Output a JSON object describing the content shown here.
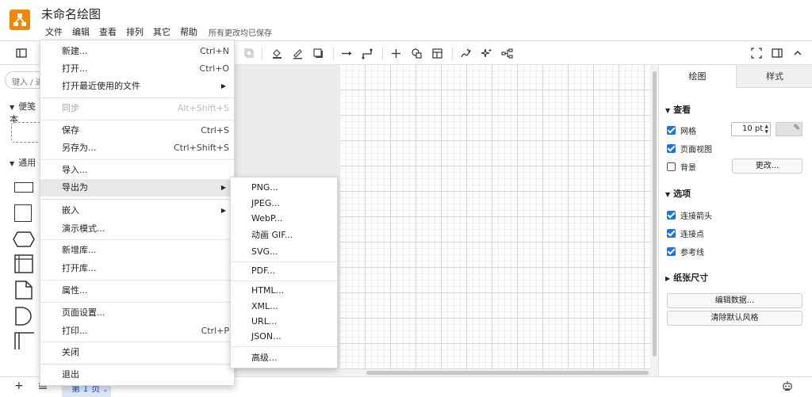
{
  "header": {
    "title": "未命名绘图",
    "menus": [
      "文件",
      "编辑",
      "查看",
      "排列",
      "其它",
      "帮助"
    ],
    "save_status": "所有更改均已保存"
  },
  "sidebar": {
    "search_placeholder": "键入 / 进",
    "sections": [
      {
        "label": "便笺本"
      },
      {
        "label": "通用"
      }
    ]
  },
  "file_menu": {
    "items": [
      {
        "label": "新建...",
        "shortcut": "Ctrl+N"
      },
      {
        "label": "打开...",
        "shortcut": "Ctrl+O"
      },
      {
        "label": "打开最近使用的文件",
        "submenu": true
      },
      {
        "label": "同步",
        "shortcut": "Alt+Shift+S",
        "disabled": true
      },
      {
        "label": "保存",
        "shortcut": "Ctrl+S"
      },
      {
        "label": "另存为...",
        "shortcut": "Ctrl+Shift+S"
      },
      {
        "label": "导入..."
      },
      {
        "label": "导出为",
        "submenu": true,
        "highlighted": true
      },
      {
        "label": "嵌入",
        "submenu": true
      },
      {
        "label": "演示模式..."
      },
      {
        "label": "新增库..."
      },
      {
        "label": "打开库..."
      },
      {
        "label": "属性..."
      },
      {
        "label": "页面设置..."
      },
      {
        "label": "打印...",
        "shortcut": "Ctrl+P"
      },
      {
        "label": "关闭"
      },
      {
        "label": "退出"
      }
    ]
  },
  "export_menu": {
    "items": [
      {
        "label": "PNG..."
      },
      {
        "label": "JPEG..."
      },
      {
        "label": "WebP..."
      },
      {
        "label": "动画 GIF..."
      },
      {
        "label": "SVG..."
      },
      {
        "label": "PDF..."
      },
      {
        "label": "HTML..."
      },
      {
        "label": "XML..."
      },
      {
        "label": "URL..."
      },
      {
        "label": "JSON..."
      },
      {
        "label": "高级..."
      }
    ]
  },
  "format_panel": {
    "tabs": [
      "绘图",
      "样式"
    ],
    "view_section": "查看",
    "grid_label": "网格",
    "grid_checked": true,
    "grid_size": "10 pt",
    "grid_color": "#e0e0e0",
    "page_view_label": "页面视图",
    "page_view_checked": true,
    "background_label": "背景",
    "background_checked": false,
    "change_button": "更改...",
    "options_section": "选项",
    "connection_arrows_label": "连接箭头",
    "connection_points_label": "连接点",
    "guides_label": "参考线",
    "paper_size_section": "纸张尺寸",
    "edit_data_button": "编辑数据...",
    "clear_style_button": "清除默认风格"
  },
  "bottom": {
    "page_tab": "第 1 页"
  },
  "colors": {
    "logo": "#f08705",
    "accent": "#1a73e8",
    "page_tab_bg": "#dde6f7"
  }
}
